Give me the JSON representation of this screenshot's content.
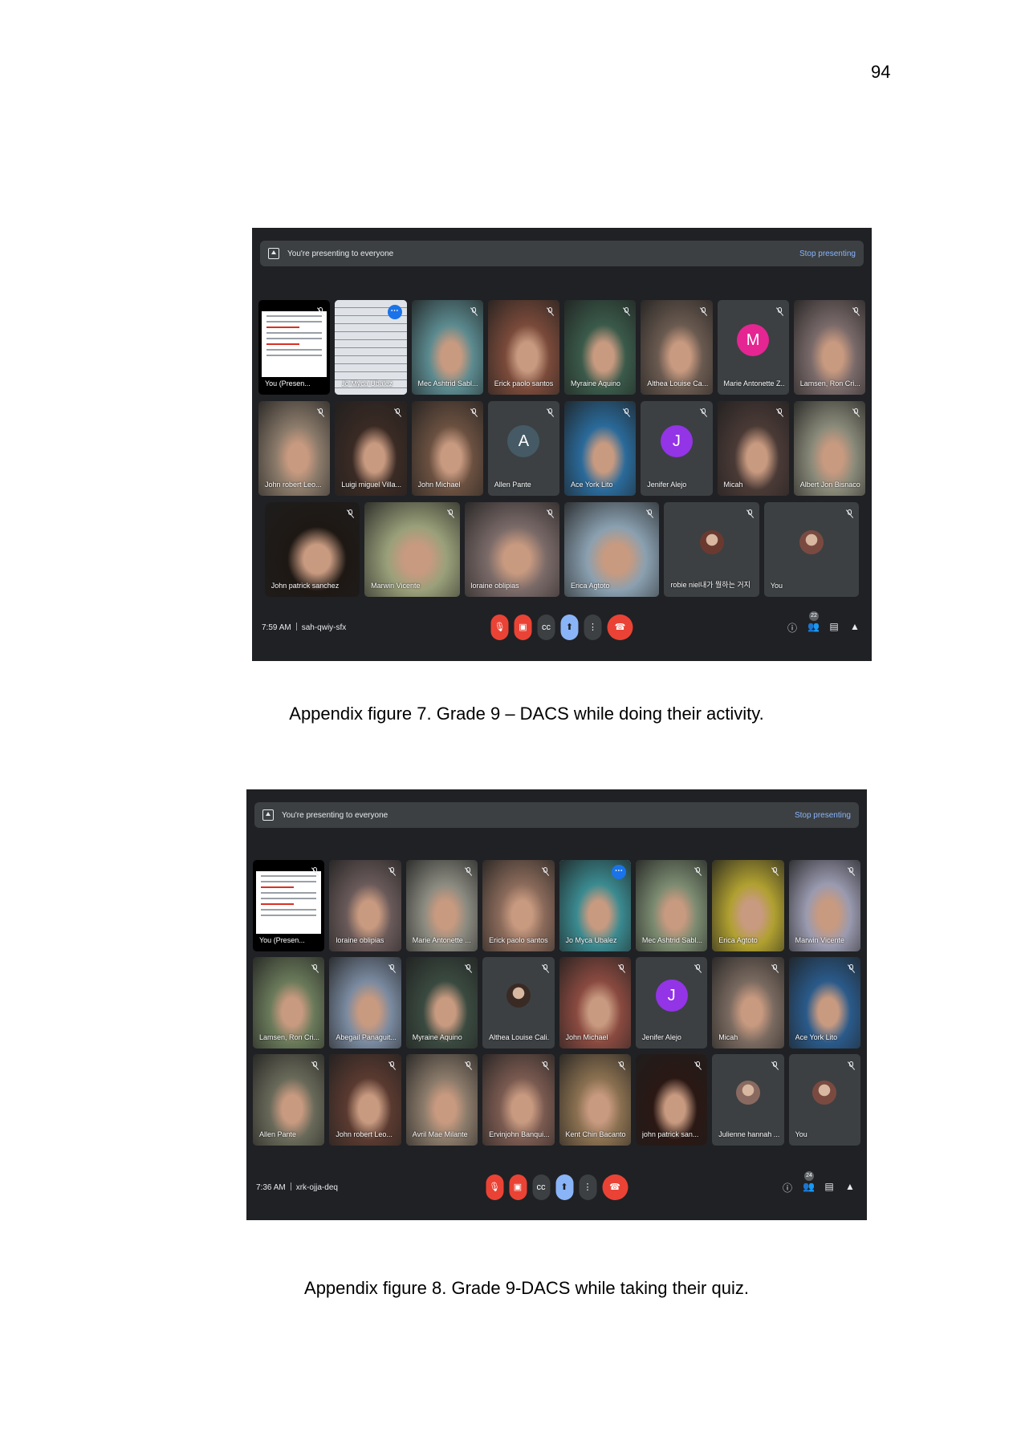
{
  "page_number": "94",
  "figures": [
    {
      "banner_text": "You're presenting to everyone",
      "stop_label": "Stop presenting",
      "time": "7:59 AM",
      "meeting_code": "sah-qwiy-sfx",
      "people_count": "22",
      "caption": "Appendix figure 7. Grade 9 – DACS while doing their activity.",
      "rows": [
        [
          {
            "name": "You (Presen...",
            "kind": "screen"
          },
          {
            "name": "Jo Myca Ubalez",
            "kind": "whiteboard",
            "selected": true
          },
          {
            "name": "Mec Ashtrid Sabl...",
            "kind": "photo",
            "color": "#5b8a8f"
          },
          {
            "name": "Erick paolo santos",
            "kind": "photo",
            "color": "#7a4a3a"
          },
          {
            "name": "Myraine Aquino",
            "kind": "photo",
            "color": "#3a5a4a"
          },
          {
            "name": "Althea Louise Ca...",
            "kind": "photo",
            "color": "#6a5a50"
          },
          {
            "name": "Marie Antonette Z...",
            "kind": "avatar",
            "initial": "M",
            "color": "#e52592"
          },
          {
            "name": "Lamsen, Ron Cri...",
            "kind": "photo",
            "color": "#7a6a6a"
          }
        ],
        [
          {
            "name": "John robert Leo...",
            "kind": "photo",
            "color": "#8a7a6a"
          },
          {
            "name": "Luigi miguel Villa...",
            "kind": "photo",
            "color": "#3a2a24"
          },
          {
            "name": "John Michael",
            "kind": "photo",
            "color": "#6a5040"
          },
          {
            "name": "Allen Pante",
            "kind": "avatar",
            "initial": "A",
            "color": "#455a64"
          },
          {
            "name": "Ace York Lito",
            "kind": "photo",
            "color": "#2a6a9a"
          },
          {
            "name": "Jenifer Alejo",
            "kind": "avatar",
            "initial": "J",
            "color": "#9334e6"
          },
          {
            "name": "Micah",
            "kind": "photo",
            "color": "#4a3a36"
          },
          {
            "name": "Albert Jon Bisnaco",
            "kind": "photo",
            "color": "#8a8a7a"
          }
        ],
        [
          {
            "name": "John patrick sanchez",
            "kind": "photo",
            "color": "#1e1814"
          },
          {
            "name": "Marwin Vicente",
            "kind": "photo",
            "color": "#9aa07a"
          },
          {
            "name": "loraine oblipias",
            "kind": "photo",
            "color": "#7a6a68"
          },
          {
            "name": "Erica Agtoto",
            "kind": "photo",
            "color": "#8aa0b0"
          },
          {
            "name": "robie niel내가 뭘하는 거지",
            "kind": "avatar-photo",
            "color": "#6a3a30"
          },
          {
            "name": "You",
            "kind": "avatar-photo",
            "color": "#7a4a40"
          }
        ]
      ]
    },
    {
      "banner_text": "You're presenting to everyone",
      "stop_label": "Stop presenting",
      "time": "7:36 AM",
      "meeting_code": "xrk-ojja-deq",
      "people_count": "24",
      "caption": "Appendix figure 8. Grade 9-DACS while taking their quiz.",
      "rows": [
        [
          {
            "name": "You (Presen...",
            "kind": "screen"
          },
          {
            "name": "loraine oblipias",
            "kind": "photo",
            "color": "#6a5a5a"
          },
          {
            "name": "Marie Antonette ...",
            "kind": "photo",
            "color": "#8a8a80"
          },
          {
            "name": "Erick paolo santos",
            "kind": "photo",
            "color": "#8a6a5a"
          },
          {
            "name": "Jo Myca Ubalez",
            "kind": "photo",
            "color": "#3a8a90",
            "selected": true
          },
          {
            "name": "Mec Ashtrid Sabl...",
            "kind": "photo",
            "color": "#7a8a70"
          },
          {
            "name": "Erica Agtoto",
            "kind": "photo",
            "color": "#b0a030"
          },
          {
            "name": "Marwin Vicente",
            "kind": "photo",
            "color": "#9a9ab0"
          }
        ],
        [
          {
            "name": "Lamsen, Ron Cri...",
            "kind": "photo",
            "color": "#6a7a5a"
          },
          {
            "name": "Abegail Panaguit...",
            "kind": "photo",
            "color": "#7a8aa0"
          },
          {
            "name": "Myraine Aquino",
            "kind": "photo",
            "color": "#3a4a40"
          },
          {
            "name": "Althea Louise Cali...",
            "kind": "avatar-photo",
            "color": "#3a2a24"
          },
          {
            "name": "John Michael",
            "kind": "photo",
            "color": "#8a4a40"
          },
          {
            "name": "Jenifer Alejo",
            "kind": "avatar",
            "initial": "J",
            "color": "#9334e6"
          },
          {
            "name": "Micah",
            "kind": "photo",
            "color": "#7a6a60"
          },
          {
            "name": "Ace York Lito",
            "kind": "photo",
            "color": "#2a5a8a"
          }
        ],
        [
          {
            "name": "Allen Pante",
            "kind": "photo",
            "color": "#6a6a5a"
          },
          {
            "name": "John robert Leo...",
            "kind": "photo",
            "color": "#5a3a30"
          },
          {
            "name": "Avril Mae Milante",
            "kind": "photo",
            "color": "#8a7a6a"
          },
          {
            "name": "Ervinjohn Banqui...",
            "kind": "photo",
            "color": "#7a5a50"
          },
          {
            "name": "Kent Chin Bacanto",
            "kind": "photo",
            "color": "#8a7050"
          },
          {
            "name": "john patrick san...",
            "kind": "photo",
            "color": "#2a1814"
          },
          {
            "name": "Julienne hannah ...",
            "kind": "avatar-photo",
            "color": "#8a6a60"
          },
          {
            "name": "You",
            "kind": "avatar-photo",
            "color": "#7a4a40"
          }
        ]
      ]
    }
  ],
  "colors": {
    "meet_bg": "#202124",
    "tile_bg": "#3c4043",
    "accent_blue": "#8ab4f8",
    "red": "#ea4335"
  }
}
